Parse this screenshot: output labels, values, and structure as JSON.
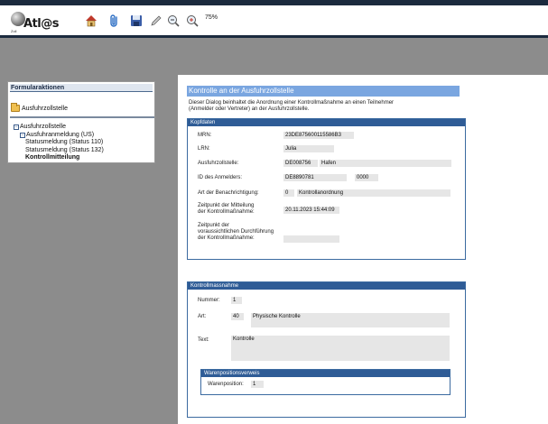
{
  "app": {
    "logo_text": "Atl@s",
    "logo_small": "Zoll",
    "zoom": "75%"
  },
  "sidebar": {
    "title": "Formularaktionen",
    "folder_label": "Ausfuhrzollstelle",
    "tree": [
      {
        "label": "Ausfuhrzollstelle"
      },
      {
        "label": "Ausfuhranmeldung (US)"
      },
      {
        "label": "Statusmeldung (Status 110)"
      },
      {
        "label": "Statusmeldung (Status 132)"
      },
      {
        "label": "Kontrollmitteilung"
      }
    ]
  },
  "main": {
    "title": "Kontrolle an der Ausfuhrzollstelle",
    "intro": "Dieser Dialog beinhaltet die Anordnung einer Kontrollmaßnahme an einen Teilnehmer (Anmelder oder Vertreter) an der Ausfuhrzollstelle.",
    "kopfdaten": {
      "heading": "Kopfdaten",
      "mrn_label": "MRN:",
      "mrn_value": "23DE875600115586B3",
      "lrn_label": "LRN:",
      "lrn_value": "Julia",
      "zollstelle_label": "Ausfuhrzollstelle:",
      "zollstelle_code": "DE008756",
      "zollstelle_name": "Hafen",
      "anmelder_label": "ID des Anmelders:",
      "anmelder_id": "DE8890781",
      "anmelder_nr": "0000",
      "benachrichtigung_label": "Art der Benachrichtigung:",
      "benachrichtigung_code": "0",
      "benachrichtigung_text": "Kontrollanordnung",
      "zeit_mitteilung_label_1": "Zeitpunkt der Mitteilung",
      "zeit_mitteilung_label_2": "der Kontrollmaßnahme:",
      "zeit_mitteilung_value": "20.11.2023 15:44:09",
      "zeit_durchf_label_1": "Zeitpunkt der",
      "zeit_durchf_label_2": "voraussichtlichen Durchführung",
      "zeit_durchf_label_3": "der Kontrollmaßnahme:",
      "zeit_durchf_value": ""
    },
    "kontrolle": {
      "heading": "Kontrollmassnahme",
      "nummer_label": "Nummer:",
      "nummer_value": "1",
      "art_label": "Art:",
      "art_code": "40",
      "art_text": "Physische Kontrolle",
      "text_label": "Text:",
      "text_value": "Kontrolle",
      "warenpos": {
        "heading": "Warenpositionsverweis",
        "label": "Warenposition:",
        "value": "1"
      }
    }
  },
  "colors": {
    "top_bar": "#1b2a3e",
    "title_bar": "#7aa6e0",
    "section_header": "#2f5c96",
    "field_bg": "#e6e6e6",
    "background": "#8c8c8c"
  }
}
